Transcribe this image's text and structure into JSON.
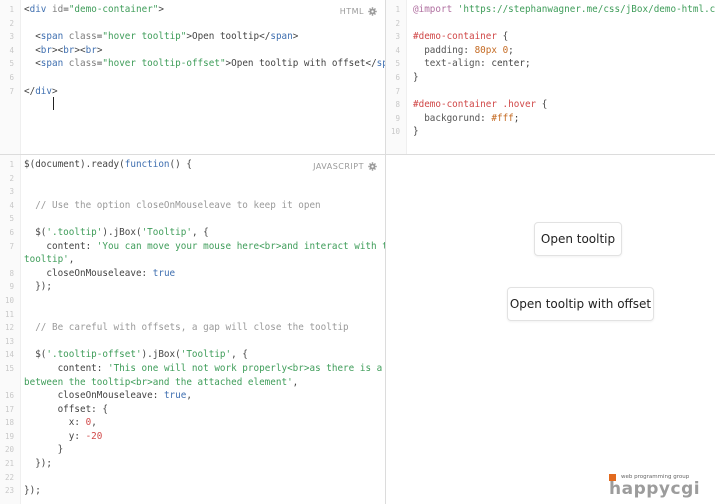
{
  "html_pane": {
    "label": "HTML",
    "lines": [
      {
        "n": "1",
        "parts": [
          [
            "plain",
            "<"
          ],
          [
            "tag-name",
            "div"
          ],
          [
            "plain",
            " "
          ],
          [
            "attr",
            "id"
          ],
          [
            "plain",
            "="
          ],
          [
            "str",
            "\"demo-container\""
          ],
          [
            "plain",
            ">"
          ]
        ]
      },
      {
        "n": "2",
        "parts": []
      },
      {
        "n": "3",
        "parts": [
          [
            "plain",
            "  <"
          ],
          [
            "tag-name",
            "span"
          ],
          [
            "plain",
            " "
          ],
          [
            "attr",
            "class"
          ],
          [
            "plain",
            "="
          ],
          [
            "str",
            "\"hover tooltip\""
          ],
          [
            "plain",
            ">Open tooltip</"
          ],
          [
            "tag-name",
            "span"
          ],
          [
            "plain",
            ">"
          ]
        ]
      },
      {
        "n": "4",
        "parts": [
          [
            "plain",
            "  <"
          ],
          [
            "tag-name",
            "br"
          ],
          [
            "plain",
            "><"
          ],
          [
            "tag-name",
            "br"
          ],
          [
            "plain",
            "><"
          ],
          [
            "tag-name",
            "br"
          ],
          [
            "plain",
            ">"
          ]
        ]
      },
      {
        "n": "5",
        "parts": [
          [
            "plain",
            "  <"
          ],
          [
            "tag-name",
            "span"
          ],
          [
            "plain",
            " "
          ],
          [
            "attr",
            "class"
          ],
          [
            "plain",
            "="
          ],
          [
            "str",
            "\"hover tooltip-offset\""
          ],
          [
            "plain",
            ">Open tooltip with offset</"
          ],
          [
            "tag-name",
            "span"
          ],
          [
            "plain",
            ">"
          ]
        ]
      },
      {
        "n": "6",
        "parts": []
      },
      {
        "n": "7",
        "parts": [
          [
            "plain",
            "</"
          ],
          [
            "tag-name",
            "div"
          ],
          [
            "plain",
            ">"
          ]
        ]
      }
    ]
  },
  "css_pane": {
    "lines": [
      {
        "n": "1",
        "parts": [
          [
            "at",
            "@import"
          ],
          [
            "plain",
            " "
          ],
          [
            "str",
            "'https://stephanwagner.me/css/jBox/demo-html.css'"
          ],
          [
            "plain",
            ";"
          ]
        ]
      },
      {
        "n": "2",
        "parts": []
      },
      {
        "n": "3",
        "parts": [
          [
            "sel",
            "#demo-container"
          ],
          [
            "plain",
            " {"
          ]
        ]
      },
      {
        "n": "4",
        "parts": [
          [
            "prop",
            "  padding"
          ],
          [
            "plain",
            ": "
          ],
          [
            "hex",
            "80px 0"
          ],
          [
            "plain",
            ";"
          ]
        ]
      },
      {
        "n": "5",
        "parts": [
          [
            "prop",
            "  text-align"
          ],
          [
            "plain",
            ": center;"
          ]
        ]
      },
      {
        "n": "6",
        "parts": [
          [
            "plain",
            "}"
          ]
        ]
      },
      {
        "n": "7",
        "parts": []
      },
      {
        "n": "8",
        "parts": [
          [
            "sel",
            "#demo-container .hover"
          ],
          [
            "plain",
            " {"
          ]
        ]
      },
      {
        "n": "9",
        "parts": [
          [
            "prop",
            "  backgorund"
          ],
          [
            "plain",
            ": "
          ],
          [
            "hex",
            "#fff"
          ],
          [
            "plain",
            ";"
          ]
        ]
      },
      {
        "n": "10",
        "parts": [
          [
            "plain",
            "}"
          ]
        ]
      }
    ]
  },
  "js_pane": {
    "label": "JAVASCRIPT",
    "lines": [
      {
        "n": "1",
        "parts": [
          [
            "plain",
            "$(document).ready("
          ],
          [
            "kw",
            "function"
          ],
          [
            "plain",
            "() {"
          ]
        ]
      },
      {
        "n": "2",
        "parts": []
      },
      {
        "n": "3",
        "parts": []
      },
      {
        "n": "4",
        "parts": [
          [
            "cmt",
            "  // Use the option closeOnMouseleave to keep it open"
          ]
        ]
      },
      {
        "n": "5",
        "parts": []
      },
      {
        "n": "6",
        "parts": [
          [
            "plain",
            "  $("
          ],
          [
            "str",
            "'.tooltip'"
          ],
          [
            "plain",
            ").jBox("
          ],
          [
            "str",
            "'Tooltip'"
          ],
          [
            "plain",
            ", {"
          ]
        ]
      },
      {
        "n": "7",
        "parts": [
          [
            "plain",
            "    content: "
          ],
          [
            "str",
            "'You can move your mouse here<br>and interact with this"
          ]
        ]
      },
      {
        "n": "",
        "parts": [
          [
            "str",
            "tooltip'"
          ],
          [
            "plain",
            ","
          ]
        ]
      },
      {
        "n": "8",
        "parts": [
          [
            "plain",
            "    closeOnMouseleave: "
          ],
          [
            "kw",
            "true"
          ]
        ]
      },
      {
        "n": "9",
        "parts": [
          [
            "plain",
            "  });"
          ]
        ]
      },
      {
        "n": "10",
        "parts": []
      },
      {
        "n": "11",
        "parts": []
      },
      {
        "n": "12",
        "parts": [
          [
            "cmt",
            "  // Be careful with offsets, a gap will close the tooltip"
          ]
        ]
      },
      {
        "n": "13",
        "parts": []
      },
      {
        "n": "14",
        "parts": [
          [
            "plain",
            "  $("
          ],
          [
            "str",
            "'.tooltip-offset'"
          ],
          [
            "plain",
            ").jBox("
          ],
          [
            "str",
            "'Tooltip'"
          ],
          [
            "plain",
            ", {"
          ]
        ]
      },
      {
        "n": "15",
        "parts": [
          [
            "plain",
            "      content: "
          ],
          [
            "str",
            "'This one will not work properly<br>as there is a gap"
          ]
        ]
      },
      {
        "n": "",
        "parts": [
          [
            "str",
            "between the tooltip<br>and the attached element'"
          ],
          [
            "plain",
            ","
          ]
        ]
      },
      {
        "n": "16",
        "parts": [
          [
            "plain",
            "      closeOnMouseleave: "
          ],
          [
            "kw",
            "true"
          ],
          [
            "plain",
            ","
          ]
        ]
      },
      {
        "n": "17",
        "parts": [
          [
            "plain",
            "      offset: {"
          ]
        ]
      },
      {
        "n": "18",
        "parts": [
          [
            "plain",
            "        x: "
          ],
          [
            "num",
            "0"
          ],
          [
            "plain",
            ","
          ]
        ]
      },
      {
        "n": "19",
        "parts": [
          [
            "plain",
            "        y: "
          ],
          [
            "num",
            "-20"
          ]
        ]
      },
      {
        "n": "20",
        "parts": [
          [
            "plain",
            "      }"
          ]
        ]
      },
      {
        "n": "21",
        "parts": [
          [
            "plain",
            "  });"
          ]
        ]
      },
      {
        "n": "22",
        "parts": []
      },
      {
        "n": "23",
        "parts": [
          [
            "plain",
            "});"
          ]
        ]
      }
    ]
  },
  "result_pane": {
    "tooltip_button": "Open tooltip",
    "tooltip_offset_button": "Open tooltip with offset"
  },
  "branding": {
    "tagline": "web programming group",
    "name": "happycgi",
    "accent_color": "#e26a1e"
  },
  "icons": {
    "settings": "gear-icon"
  }
}
